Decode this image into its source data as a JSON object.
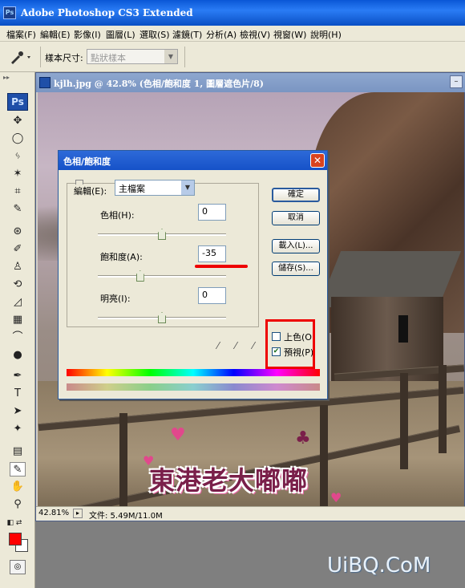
{
  "app": {
    "title": "Adobe Photoshop CS3 Extended",
    "logo": "Ps"
  },
  "menu": [
    "檔案(F)",
    "編輯(E)",
    "影像(I)",
    "圖層(L)",
    "選取(S)",
    "濾鏡(T)",
    "分析(A)",
    "檢視(V)",
    "視窗(W)",
    "說明(H)"
  ],
  "options": {
    "sample_label": "樣本尺寸:",
    "sample_value": "點狀樣本"
  },
  "toolbox": {
    "badge": "Ps"
  },
  "document": {
    "title": "kjlh.jpg @ 42.8% (色相/飽和度 1, 圖層遮色片/8)",
    "zoom": "42.81%",
    "info": "文件: 5.49M/11.0M"
  },
  "dialog": {
    "title": "色相/飽和度",
    "edit_label": "編輯(E):",
    "edit_value": "主檔案",
    "hue_label": "色相(H):",
    "hue_value": "0",
    "saturation_label": "飽和度(A):",
    "saturation_value": "-35",
    "lightness_label": "明亮(I):",
    "lightness_value": "0",
    "ok_label": "確定",
    "cancel_label": "取消",
    "load_label": "載入(L)...",
    "save_label": "儲存(S)...",
    "colorize_label": "上色(O)",
    "colorize_checked": false,
    "preview_label": "預視(P)",
    "preview_checked": true,
    "slider_levels": {
      "hue": 0.5,
      "saturation": 0.33,
      "lightness": 0.5
    }
  },
  "watermark": {
    "text": "東港老大嘟嘟"
  },
  "site_mark": "UiBQ.CoM",
  "colors": {
    "foreground": "#ff0000",
    "background": "#ffffff",
    "annotation": "#e00000"
  }
}
